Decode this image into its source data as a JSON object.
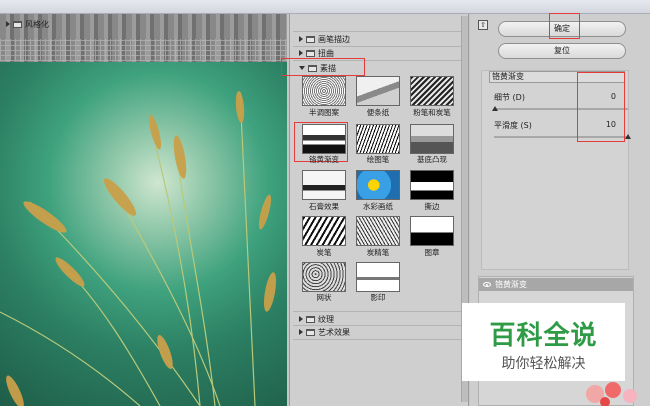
{
  "filter_categories": [
    {
      "label": "风格化",
      "expanded": false
    },
    {
      "label": "画笔描边",
      "expanded": false
    },
    {
      "label": "扭曲",
      "expanded": false
    },
    {
      "label": "素描",
      "expanded": true
    },
    {
      "label": "纹理",
      "expanded": false
    },
    {
      "label": "艺术效果",
      "expanded": false
    }
  ],
  "sketch_filters": [
    {
      "label": "半调图案",
      "selected": false
    },
    {
      "label": "便条纸",
      "selected": false
    },
    {
      "label": "粉笔和炭笔",
      "selected": false
    },
    {
      "label": "铬黄渐变",
      "selected": true
    },
    {
      "label": "绘图笔",
      "selected": false
    },
    {
      "label": "基底凸现",
      "selected": false
    },
    {
      "label": "石膏效果",
      "selected": false
    },
    {
      "label": "水彩画纸",
      "selected": false
    },
    {
      "label": "撕边",
      "selected": false
    },
    {
      "label": "炭笔",
      "selected": false
    },
    {
      "label": "炭精笔",
      "selected": false
    },
    {
      "label": "图章",
      "selected": false
    },
    {
      "label": "网状",
      "selected": false
    },
    {
      "label": "影印",
      "selected": false
    }
  ],
  "buttons": {
    "ok": "确定",
    "reset": "复位"
  },
  "settings": {
    "filter_select": "铬黄渐变",
    "detail": {
      "label": "细节 (D)",
      "value": "0",
      "level": 0.0
    },
    "smoothness": {
      "label": "平滑度 (S)",
      "value": "10",
      "level": 1.0
    }
  },
  "effect_layer": {
    "label": "铬黄渐变"
  },
  "watermark": {
    "title": "百科全说",
    "subtitle": "助你轻松解决"
  },
  "colors": {
    "highlight_red": "#e63b3b",
    "watermark_green": "#2f9b47"
  }
}
